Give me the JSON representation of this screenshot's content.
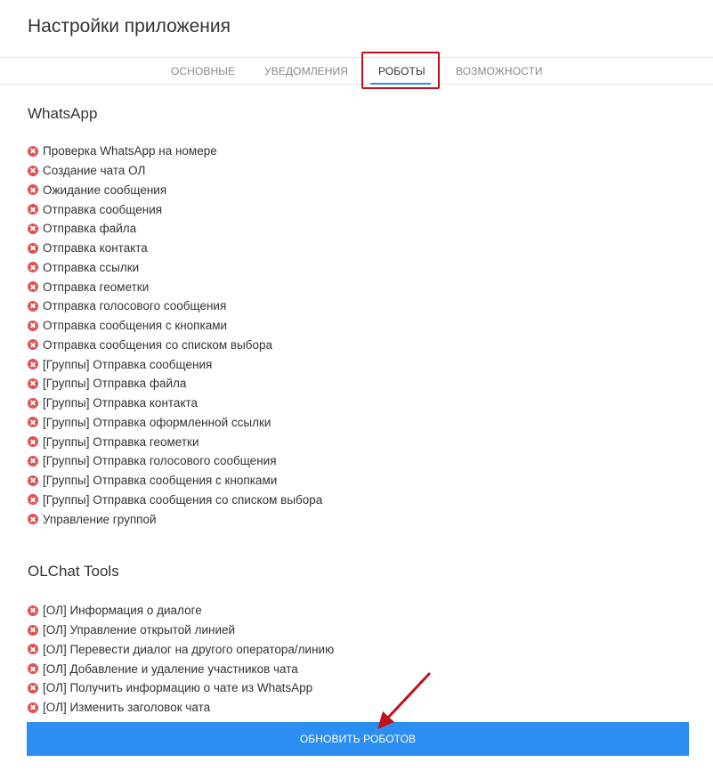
{
  "header": {
    "title": "Настройки приложения"
  },
  "tabs": [
    {
      "label": "ОСНОВНЫЕ"
    },
    {
      "label": "УВЕДОМЛЕНИЯ"
    },
    {
      "label": "РОБОТЫ"
    },
    {
      "label": "ВОЗМОЖНОСТИ"
    }
  ],
  "active_tab": "РОБОТЫ",
  "accent_color": "#2d8ef2",
  "highlight_color": "#c0121c",
  "error_icon": "error-circle-x-icon",
  "error_icon_color": "#e05252",
  "whatsapp": {
    "title": "WhatsApp",
    "items": [
      "Проверка WhatsApp на номере",
      "Создание чата ОЛ",
      "Ожидание сообщения",
      "Отправка сообщения",
      "Отправка файла",
      "Отправка контакта",
      "Отправка ссылки",
      "Отправка геометки",
      "Отправка голосового сообщения",
      "Отправка сообщения с кнопками",
      "Отправка сообщения со списком выбора",
      "[Группы] Отправка сообщения",
      "[Группы] Отправка файла",
      "[Группы] Отправка контакта",
      "[Группы] Отправка оформленной ссылки",
      "[Группы] Отправка геометки",
      "[Группы] Отправка голосового сообщения",
      "[Группы] Отправка сообщения с кнопками",
      "[Группы] Отправка сообщения со списком выбора",
      "Управление группой"
    ]
  },
  "olchat": {
    "title": "OLChat Tools",
    "items": [
      "[ОЛ] Информация о диалоге",
      "[ОЛ] Управление открытой линией",
      "[ОЛ] Перевести диалог на другого оператора/линию",
      "[ОЛ] Добавление и удаление участников чата",
      "[ОЛ] Получить информацию о чате из WhatsApp",
      "[ОЛ] Изменить заголовок чата"
    ]
  },
  "update_button": {
    "label": "ОБНОВИТЬ РОБОТОВ"
  }
}
